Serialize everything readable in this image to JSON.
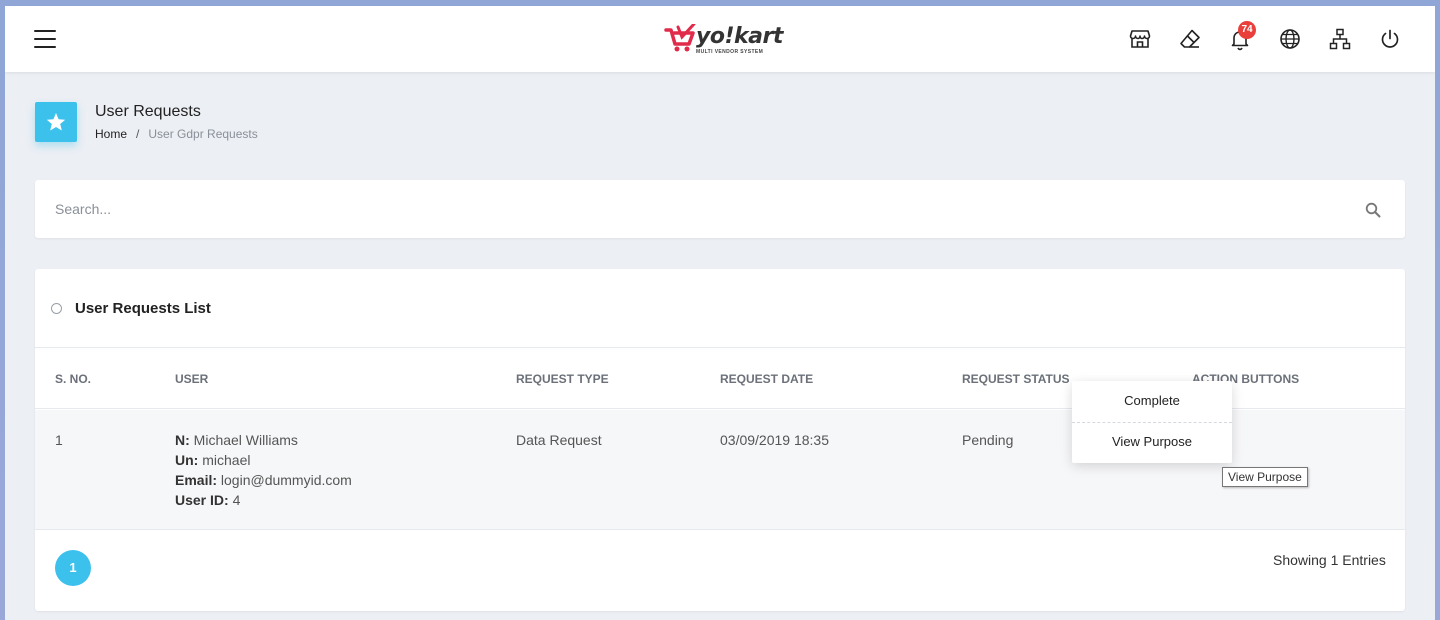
{
  "header": {
    "logo_text": "yo!kart",
    "logo_subtitle": "MULTI VENDOR SYSTEM",
    "notification_count": "74",
    "icons": [
      "menu-icon",
      "store-icon",
      "eraser-icon",
      "bell-icon",
      "globe-icon",
      "sitemap-icon",
      "power-icon"
    ],
    "accent_color": "#3bc1ec",
    "badge_color": "#e9403b"
  },
  "page": {
    "title": "User Requests",
    "breadcrumb": {
      "home": "Home",
      "separator": "/",
      "current": "User Gdpr Requests"
    }
  },
  "search": {
    "placeholder": "Search..."
  },
  "list": {
    "title": "User Requests List",
    "columns": [
      "S. NO.",
      "USER",
      "REQUEST TYPE",
      "REQUEST DATE",
      "REQUEST STATUS",
      "ACTION BUTTONS"
    ],
    "rows": [
      {
        "sno": "1",
        "user": {
          "name_label": "N:",
          "name": "Michael Williams",
          "username_label": "Un:",
          "username": "michael",
          "email_label": "Email:",
          "email": "login@dummyid.com",
          "userid_label": "User ID:",
          "userid": "4"
        },
        "request_type": "Data Request",
        "request_date": "03/09/2019 18:35",
        "request_status": "Pending"
      }
    ]
  },
  "pagination": {
    "current_page": "1",
    "showing": "Showing 1 Entries"
  },
  "action_menu": {
    "items": [
      "Complete",
      "View Purpose"
    ]
  },
  "tooltip": "View Purpose"
}
